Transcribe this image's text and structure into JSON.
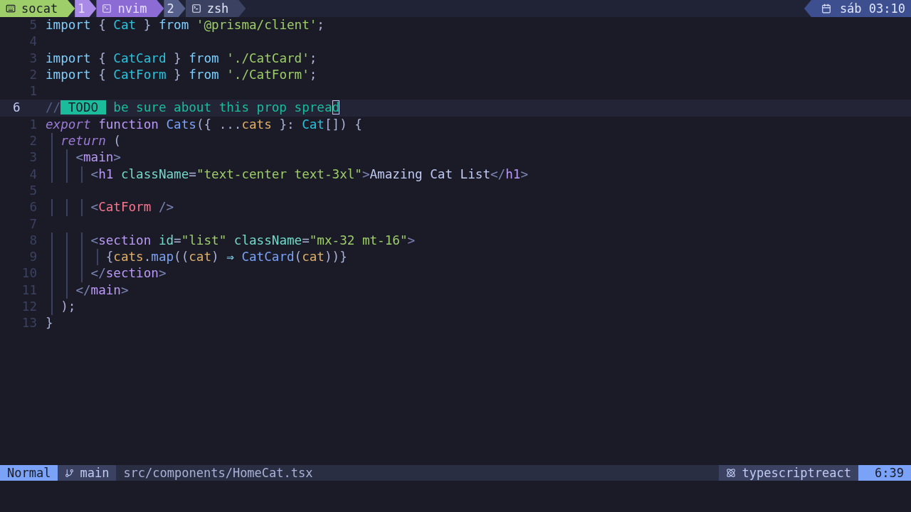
{
  "tmux": {
    "session": "socat",
    "windows": [
      {
        "index": "1",
        "name": "nvim",
        "selected": true
      },
      {
        "index": "2",
        "name": "zsh",
        "selected": false
      }
    ],
    "clock": "sáb 03:10"
  },
  "editor": {
    "lines": [
      {
        "number": "5",
        "current": false,
        "tokens": [
          {
            "kind": "kw",
            "text": "import"
          },
          {
            "kind": "p",
            "text": " { "
          },
          {
            "kind": "ty",
            "text": "Cat"
          },
          {
            "kind": "p",
            "text": " } "
          },
          {
            "kind": "kw",
            "text": "from"
          },
          {
            "kind": "str",
            "text": " '@prisma/client'"
          },
          {
            "kind": "p",
            "text": ";"
          }
        ]
      },
      {
        "number": "4",
        "current": false
      },
      {
        "number": "3",
        "current": false,
        "tokens": [
          {
            "kind": "kw",
            "text": "import"
          },
          {
            "kind": "p",
            "text": " { "
          },
          {
            "kind": "ty",
            "text": "CatCard"
          },
          {
            "kind": "p",
            "text": " } "
          },
          {
            "kind": "kw",
            "text": "from"
          },
          {
            "kind": "str",
            "text": " './CatCard'"
          },
          {
            "kind": "p",
            "text": ";"
          }
        ]
      },
      {
        "number": "2",
        "current": false,
        "tokens": [
          {
            "kind": "kw",
            "text": "import"
          },
          {
            "kind": "p",
            "text": " { "
          },
          {
            "kind": "ty",
            "text": "CatForm"
          },
          {
            "kind": "p",
            "text": " } "
          },
          {
            "kind": "kw",
            "text": "from"
          },
          {
            "kind": "str",
            "text": " './CatForm'"
          },
          {
            "kind": "p",
            "text": ";"
          }
        ]
      },
      {
        "number": "1",
        "current": false
      },
      {
        "number": "6",
        "current": true,
        "tokens": [
          {
            "kind": "com",
            "text": "//"
          },
          {
            "kind": "todo",
            "text": " TODO "
          },
          {
            "kind": "todotext",
            "text": " be sure about this prop sprea"
          },
          {
            "kind": "cursor",
            "text": "d"
          }
        ]
      },
      {
        "number": "1",
        "current": false,
        "tokens": [
          {
            "kind": "ikw",
            "text": "export"
          },
          {
            "kind": "fn",
            "text": " function"
          },
          {
            "kind": "name",
            "text": " Cats"
          },
          {
            "kind": "p",
            "text": "({ ..."
          },
          {
            "kind": "param",
            "text": "cats"
          },
          {
            "kind": "p",
            "text": " }: "
          },
          {
            "kind": "ty",
            "text": "Cat"
          },
          {
            "kind": "p",
            "text": "[]) {"
          }
        ]
      },
      {
        "number": "2",
        "current": false,
        "tokens": [
          {
            "kind": "ikw",
            "text": "  return"
          },
          {
            "kind": "p",
            "text": " ("
          }
        ]
      },
      {
        "number": "3",
        "current": false,
        "tokens": [
          {
            "kind": "tagp",
            "text": "    <"
          },
          {
            "kind": "tag",
            "text": "main"
          },
          {
            "kind": "tagp",
            "text": ">"
          }
        ]
      },
      {
        "number": "4",
        "current": false,
        "tokens": [
          {
            "kind": "tagp",
            "text": "      <"
          },
          {
            "kind": "tag",
            "text": "h1"
          },
          {
            "kind": "attr",
            "text": " className"
          },
          {
            "kind": "p",
            "text": "="
          },
          {
            "kind": "str",
            "text": "\"text-center text-3xl\""
          },
          {
            "kind": "tagp",
            "text": ">"
          },
          {
            "kind": "text",
            "text": "Amazing Cat List"
          },
          {
            "kind": "tagp",
            "text": "</"
          },
          {
            "kind": "tag",
            "text": "h1"
          },
          {
            "kind": "tagp",
            "text": ">"
          }
        ]
      },
      {
        "number": "5",
        "current": false
      },
      {
        "number": "6",
        "current": false,
        "tokens": [
          {
            "kind": "tagp",
            "text": "      <"
          },
          {
            "kind": "comp",
            "text": "CatForm"
          },
          {
            "kind": "tagp",
            "text": " />"
          }
        ]
      },
      {
        "number": "7",
        "current": false
      },
      {
        "number": "8",
        "current": false,
        "tokens": [
          {
            "kind": "tagp",
            "text": "      <"
          },
          {
            "kind": "tag",
            "text": "section"
          },
          {
            "kind": "attr",
            "text": " id"
          },
          {
            "kind": "p",
            "text": "="
          },
          {
            "kind": "str",
            "text": "\"list\""
          },
          {
            "kind": "attr",
            "text": " className"
          },
          {
            "kind": "p",
            "text": "="
          },
          {
            "kind": "str",
            "text": "\"mx-32 mt-16\""
          },
          {
            "kind": "tagp",
            "text": ">"
          }
        ]
      },
      {
        "number": "9",
        "current": false,
        "tokens": [
          {
            "kind": "p",
            "text": "        {"
          },
          {
            "kind": "param",
            "text": "cats"
          },
          {
            "kind": "p",
            "text": "."
          },
          {
            "kind": "method",
            "text": "map"
          },
          {
            "kind": "p",
            "text": "(("
          },
          {
            "kind": "param",
            "text": "cat"
          },
          {
            "kind": "p",
            "text": ") "
          },
          {
            "kind": "op",
            "text": "⇒"
          },
          {
            "kind": "method",
            "text": " CatCard"
          },
          {
            "kind": "p",
            "text": "("
          },
          {
            "kind": "param",
            "text": "cat"
          },
          {
            "kind": "p",
            "text": "))}"
          }
        ]
      },
      {
        "number": "10",
        "current": false,
        "tokens": [
          {
            "kind": "tagp",
            "text": "      </"
          },
          {
            "kind": "tag",
            "text": "section"
          },
          {
            "kind": "tagp",
            "text": ">"
          }
        ]
      },
      {
        "number": "11",
        "current": false,
        "tokens": [
          {
            "kind": "tagp",
            "text": "    </"
          },
          {
            "kind": "tag",
            "text": "main"
          },
          {
            "kind": "tagp",
            "text": ">"
          }
        ]
      },
      {
        "number": "12",
        "current": false,
        "tokens": [
          {
            "kind": "p",
            "text": "  );"
          }
        ]
      },
      {
        "number": "13",
        "current": false,
        "tokens": [
          {
            "kind": "p",
            "text": "}"
          }
        ]
      }
    ]
  },
  "statusline": {
    "mode": "Normal",
    "branch": "main",
    "file": "src/components/HomeCat.tsx",
    "filetype": "typescriptreact",
    "position": "6:39"
  }
}
